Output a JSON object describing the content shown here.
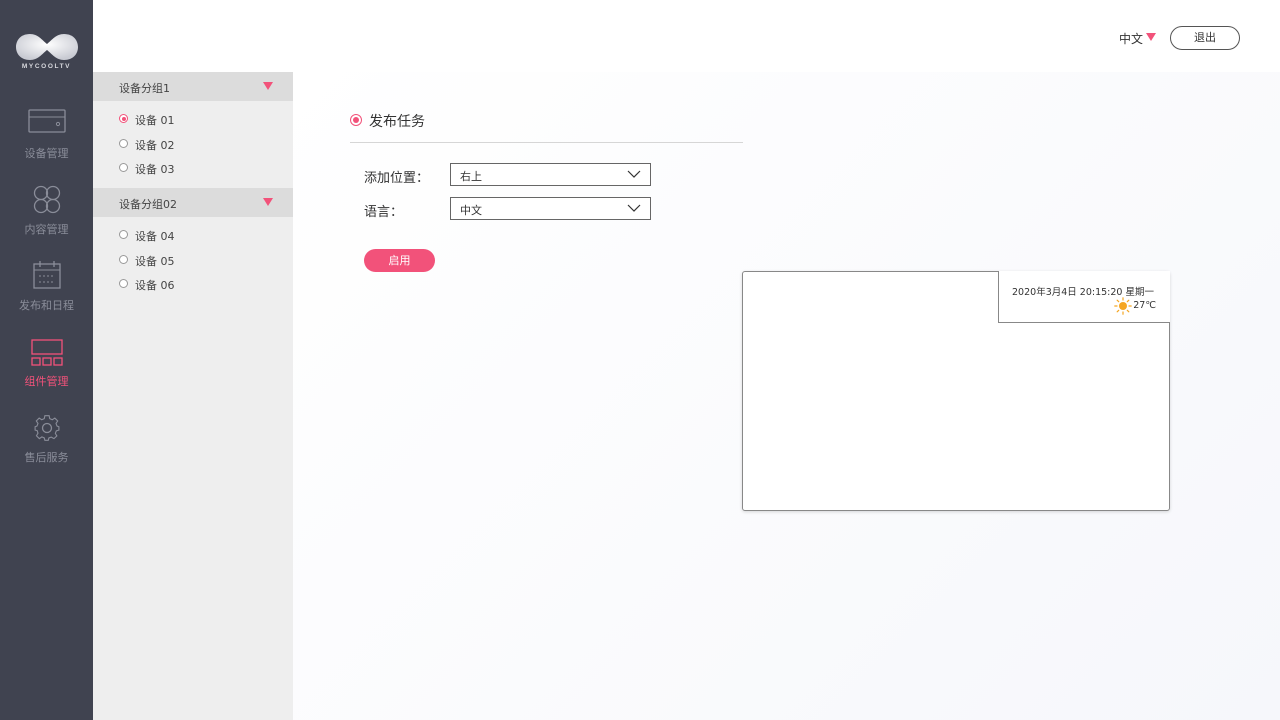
{
  "brand": {
    "name": "MYCOOLTV"
  },
  "nav": {
    "items": [
      {
        "label": "设备管理",
        "icon": "monitor-icon",
        "active": false
      },
      {
        "label": "内容管理",
        "icon": "grid-circles-icon",
        "active": false
      },
      {
        "label": "发布和日程",
        "icon": "calendar-icon",
        "active": false
      },
      {
        "label": "组件管理",
        "icon": "widget-layout-icon",
        "active": true
      },
      {
        "label": "售后服务",
        "icon": "gear-icon",
        "active": false
      }
    ]
  },
  "header": {
    "language": "中文",
    "logout_label": "退出"
  },
  "device_groups": [
    {
      "title": "设备分组1",
      "devices": [
        {
          "label": "设备 01",
          "selected": true
        },
        {
          "label": "设备 02",
          "selected": false
        },
        {
          "label": "设备 03",
          "selected": false
        }
      ]
    },
    {
      "title": "设备分组02",
      "devices": [
        {
          "label": "设备 04",
          "selected": false
        },
        {
          "label": "设备 05",
          "selected": false
        },
        {
          "label": "设备 06",
          "selected": false
        }
      ]
    }
  ],
  "task": {
    "title": "发布任务",
    "position_label": "添加位置：",
    "position_value": "右上",
    "language_label": "语言：",
    "language_value": "中文",
    "enable_label": "启用"
  },
  "preview": {
    "datetime": "2020年3月4日  20:15:20  星期一",
    "temperature": "27℃",
    "weather_icon": "sun-icon"
  },
  "colors": {
    "accent": "#f2527a",
    "nav_bg": "#404350",
    "sun": "#f5a623"
  }
}
